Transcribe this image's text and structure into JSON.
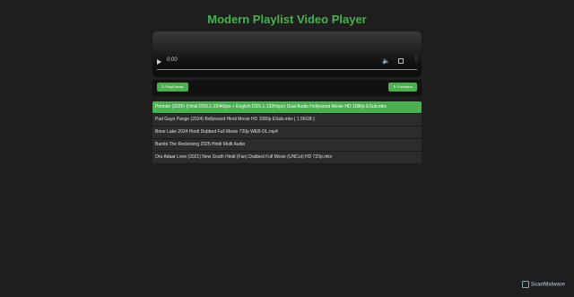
{
  "page": {
    "title": "Modern Playlist Video Player"
  },
  "player": {
    "time": "0:00",
    "icons": [
      "play-icon",
      "volume-icon",
      "fullscreen-icon",
      "more-vert-icon"
    ]
  },
  "controls": {
    "play_label": "Play/Pause",
    "follow_label": "Followers"
  },
  "playlist": {
    "items": [
      "Primate (2025) (Hindi DD5.1-224Kbps + English DD5.1-192Kbps) Dual Audio Hollywood Movie HD 1080p ESub.mkv",
      "Pad Gaye Pange (2024) Bollywood Hindi Movie HD 1080p ESub.mkv [ 1.96GB ]",
      "Bone Lake 2024 Hindi Dubbed Full Movie 720p WEB-DL.mp4",
      "Bambi The Reckoning 2025 Hindi Multi Audio",
      "Oru Adaar Love (2021) New South Hindi (Fan) Dubbed Full Movie (UNCut) HD 720p.mkv"
    ],
    "active_index": 0
  },
  "watermark": {
    "text": "ScanMalware"
  },
  "colors": {
    "accent": "#4caf50",
    "background": "#1e1e1e",
    "row": "#2c2c2c"
  }
}
